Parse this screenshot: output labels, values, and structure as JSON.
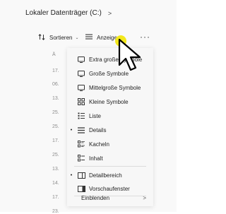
{
  "breadcrumb": {
    "location": "Lokaler Datenträger (C:)",
    "separator": ">"
  },
  "toolbar": {
    "sort_label": "Sortieren",
    "view_label": "Anzeigen",
    "more_label": "···",
    "chevron": "⌄"
  },
  "background_rows": [
    "Ä",
    "17.",
    "06.",
    "13.",
    "25.",
    "25.",
    "17.",
    "25.",
    "13.",
    "14.",
    "17.",
    "23."
  ],
  "view_menu": {
    "items": [
      {
        "icon": "monitor-icon",
        "label": "Extra große Symbole",
        "checked": false
      },
      {
        "icon": "monitor-icon",
        "label": "Große Symbole",
        "checked": false
      },
      {
        "icon": "monitor-icon",
        "label": "Mittelgroße Symbole",
        "checked": false
      },
      {
        "icon": "grid-icon",
        "label": "Kleine Symbole",
        "checked": false
      },
      {
        "icon": "list-icon",
        "label": "Liste",
        "checked": false
      },
      {
        "icon": "details-icon",
        "label": "Details",
        "checked": true
      },
      {
        "icon": "tiles-icon",
        "label": "Kacheln",
        "checked": false
      },
      {
        "icon": "content-icon",
        "label": "Inhalt",
        "checked": false
      }
    ],
    "panes": [
      {
        "icon": "details-pane-icon",
        "label": "Detailbereich",
        "checked": true
      },
      {
        "icon": "preview-pane-icon",
        "label": "Vorschaufenster",
        "checked": false
      }
    ],
    "show_label": "Einblenden",
    "submenu_arrow": ">",
    "checked_marker": "•"
  },
  "colors": {
    "highlight": "#f3e81c",
    "menu_bg": "#f7f7f7",
    "text": "#1f1f1f"
  }
}
